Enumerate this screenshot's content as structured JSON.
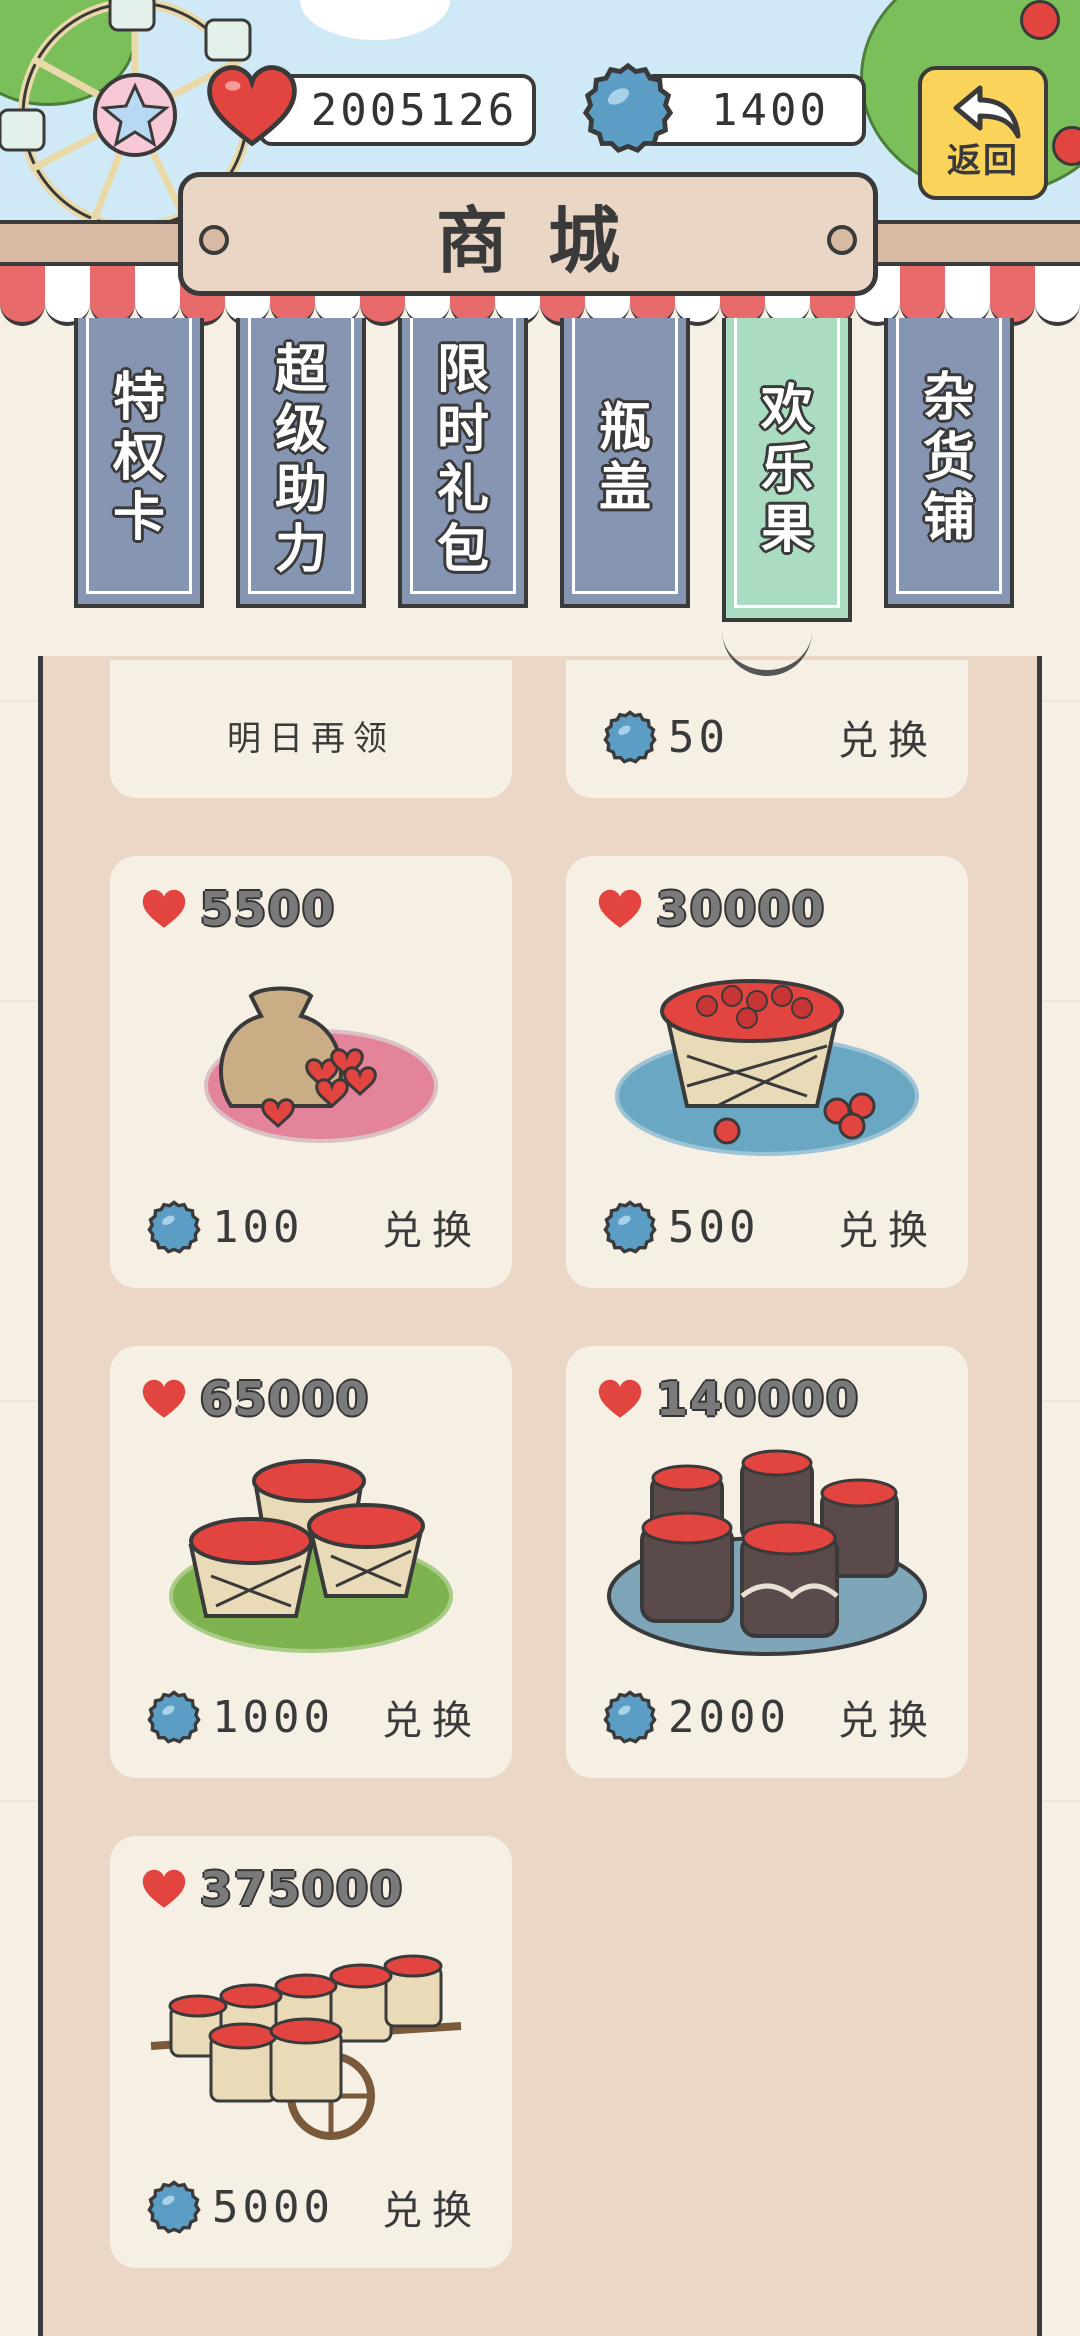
{
  "header": {
    "hearts_count": "2005126",
    "caps_count": "1400",
    "back_label": "返回"
  },
  "shop": {
    "title": "商城"
  },
  "tabs": [
    {
      "label": "特权卡",
      "active": false
    },
    {
      "label": "超级助力",
      "active": false
    },
    {
      "label": "限时礼包",
      "active": false
    },
    {
      "label": "瓶盖",
      "active": false
    },
    {
      "label": "欢乐果",
      "active": true
    },
    {
      "label": "杂货铺",
      "active": false
    }
  ],
  "top_row": {
    "left_status": "明日再领",
    "right_cost": "50",
    "right_exchange": "兑换"
  },
  "items": [
    {
      "hearts": "5500",
      "cost": "100",
      "exchange": "兑换",
      "picture": "sack-of-hearts-on-pink-mat"
    },
    {
      "hearts": "30000",
      "cost": "500",
      "exchange": "兑换",
      "picture": "basket-of-hearts-on-blue-mat"
    },
    {
      "hearts": "65000",
      "cost": "1000",
      "exchange": "兑换",
      "picture": "three-baskets-on-green-mat"
    },
    {
      "hearts": "140000",
      "cost": "2000",
      "exchange": "兑换",
      "picture": "jars-on-blue-tray"
    },
    {
      "hearts": "375000",
      "cost": "5000",
      "exchange": "兑换",
      "picture": "cart-of-baskets"
    }
  ],
  "colors": {
    "heart": "#e2453f",
    "cap": "#5b9dc4",
    "tab_inactive": "#8696b2",
    "tab_active": "#a9dcc0",
    "panel": "#ead7c5",
    "card": "#f6efe4"
  }
}
